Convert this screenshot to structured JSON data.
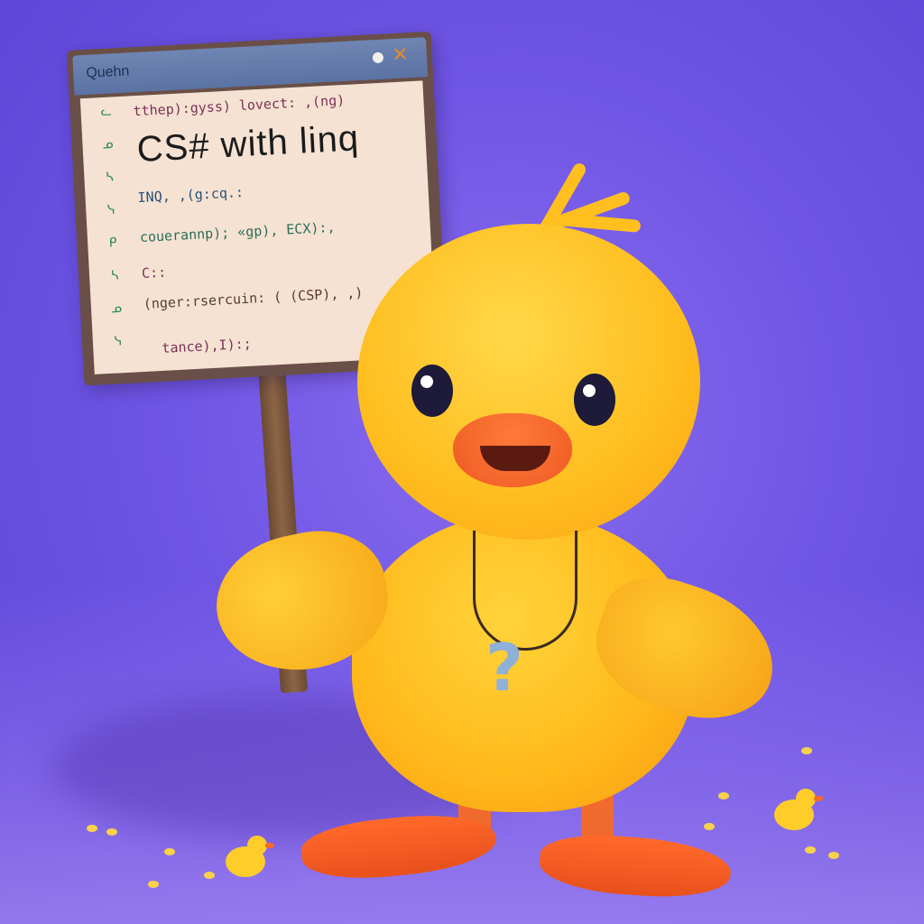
{
  "sign": {
    "window_title": "Quehn",
    "close_glyph": "✕",
    "gutter_text": "ᓚ ᓄ ᓴ ᓭ ᑭ ᓴ ᓄ ᓭ",
    "lines": [
      "tthep):gyss) lovect: ,(ng)",
      "INQ, ,(g:cq.:",
      "couerannp); «gp), ECX):,",
      "C::",
      "(nger:rsercuin: ( (CSP), ,)",
      "tance),I):;"
    ],
    "heading": "CS# with linq"
  },
  "pendant": {
    "glyph": "?"
  },
  "colors": {
    "background": "#6f56e4",
    "duck": "#ffc21f",
    "beak": "#ef5d25",
    "board": "#f5e2d2"
  }
}
